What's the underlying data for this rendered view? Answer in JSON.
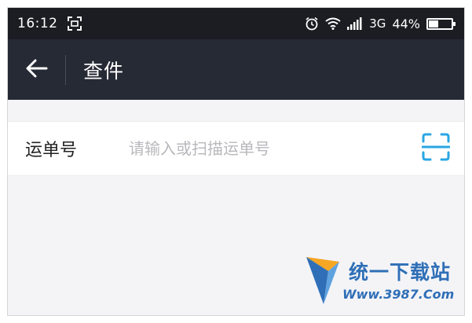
{
  "status_bar": {
    "time": "16:12",
    "network": "3G",
    "battery_percent": "44%",
    "battery_level": 0.44
  },
  "header": {
    "title": "查件"
  },
  "form": {
    "label": "运单号",
    "placeholder": "请输入或扫描运单号",
    "value": ""
  },
  "watermark": {
    "title": "统一下载站",
    "url": "Www.3987.Com"
  },
  "colors": {
    "status_bar_bg": "#1b1d22",
    "title_bar_bg": "#262a35",
    "page_bg": "#f4f4f7",
    "scan_icon": "#29a6e4",
    "watermark": "#2f6fb7"
  },
  "icons": {
    "back": "arrow-left-icon",
    "scan": "scan-icon",
    "screenshot": "screenshot-icon",
    "alarm": "alarm-icon",
    "wifi": "wifi-icon",
    "signal": "signal-icon",
    "battery": "battery-icon"
  }
}
